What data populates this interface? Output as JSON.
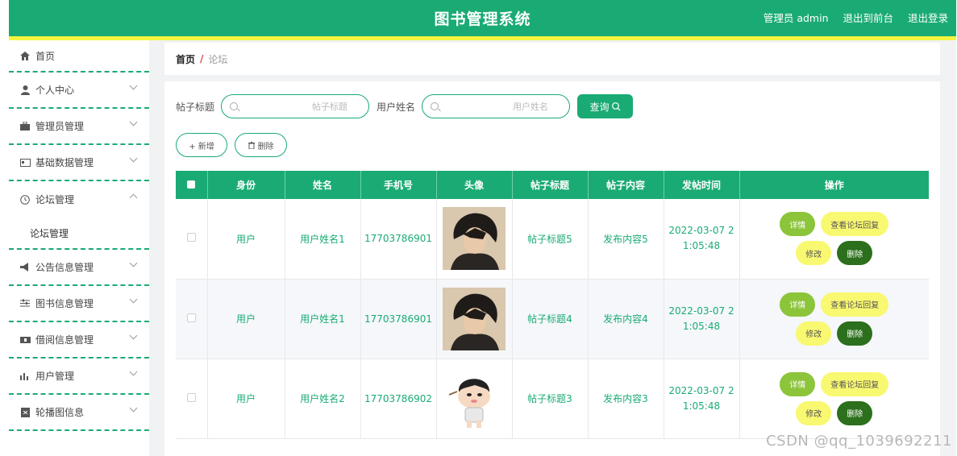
{
  "header": {
    "title": "图书管理系统",
    "admin_label": "管理员 admin",
    "back_front": "退出到前台",
    "logout": "退出登录"
  },
  "sidebar": {
    "items": [
      {
        "label": "首页",
        "icon": "home-icon"
      },
      {
        "label": "个人中心",
        "icon": "user-icon"
      },
      {
        "label": "管理员管理",
        "icon": "briefcase-icon"
      },
      {
        "label": "基础数据管理",
        "icon": "id-card-icon"
      },
      {
        "label": "论坛管理",
        "icon": "clock-icon",
        "expanded": true,
        "submenu": "论坛管理"
      },
      {
        "label": "公告信息管理",
        "icon": "megaphone-icon"
      },
      {
        "label": "图书信息管理",
        "icon": "sliders-icon"
      },
      {
        "label": "借阅信息管理",
        "icon": "ticket-icon"
      },
      {
        "label": "用户管理",
        "icon": "bar-chart-icon"
      },
      {
        "label": "轮播图信息",
        "icon": "image-icon"
      }
    ]
  },
  "breadcrumb": {
    "home": "首页",
    "sep": "/",
    "current": "论坛"
  },
  "search": {
    "title_label": "帖子标题",
    "title_placeholder": "帖子标题",
    "user_label": "用户姓名",
    "user_placeholder": "用户姓名",
    "query_button": "查询"
  },
  "actions": {
    "add": "+ 新增",
    "delete": "删除"
  },
  "table": {
    "columns": [
      "",
      "身份",
      "姓名",
      "手机号",
      "头像",
      "帖子标题",
      "帖子内容",
      "发帖时间",
      "操作"
    ],
    "rows": [
      {
        "role": "用户",
        "name": "用户姓名1",
        "phone": "17703786901",
        "avatar": "man-portrait",
        "title": "帖子标题5",
        "content": "发布内容5",
        "time": "2022-03-07 2\n1:05:48"
      },
      {
        "role": "用户",
        "name": "用户姓名1",
        "phone": "17703786901",
        "avatar": "man-portrait",
        "title": "帖子标题4",
        "content": "发布内容4",
        "time": "2022-03-07 2\n1:05:48"
      },
      {
        "role": "用户",
        "name": "用户姓名2",
        "phone": "17703786902",
        "avatar": "cartoon-boy",
        "title": "帖子标题3",
        "content": "发布内容3",
        "time": "2022-03-07 2\n1:05:48"
      }
    ],
    "ops": {
      "detail": "详情",
      "view_reply": "查看论坛回复",
      "edit": "修改",
      "delete": "删除"
    }
  },
  "watermark": "CSDN @qq_1039692211",
  "colors": {
    "primary": "#1aab74",
    "accent_yellow": "#f9f871",
    "stripe": "#f4f53f",
    "danger": "#2c6f1c",
    "detail": "#8cc43a"
  }
}
